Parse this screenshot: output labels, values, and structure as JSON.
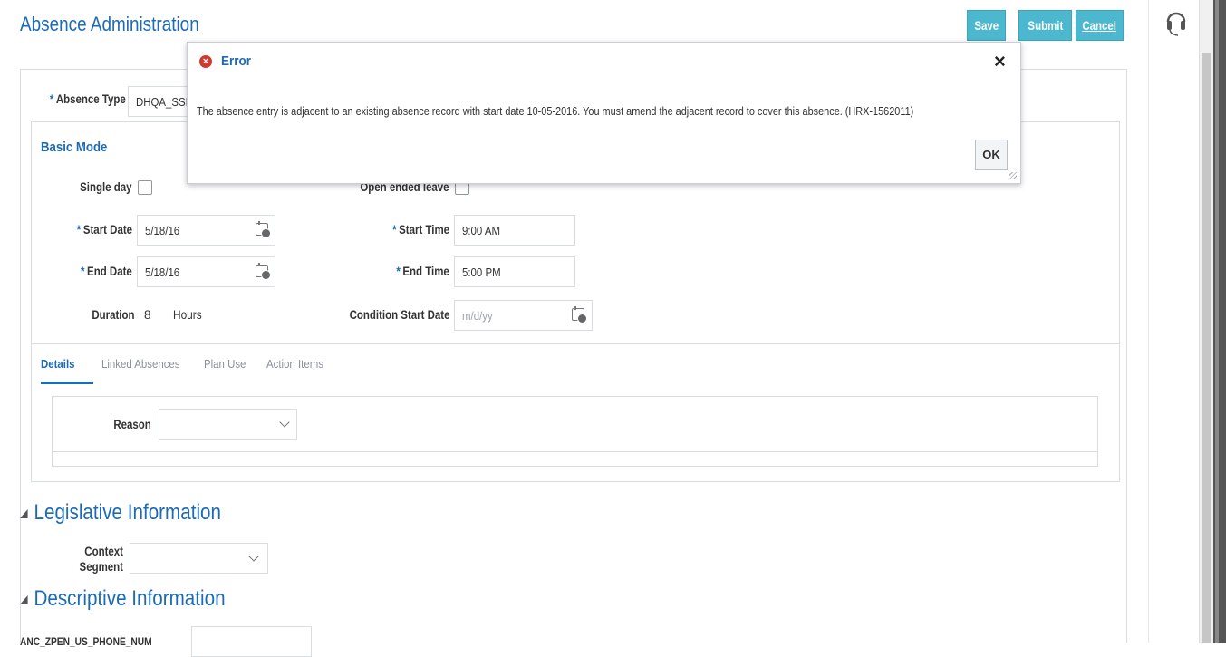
{
  "page": {
    "title": "Absence Administration",
    "save_label": "Save",
    "submit_label": "Submit",
    "cancel_label": "Cancel"
  },
  "form": {
    "absence_type_label": "Absence Type",
    "absence_type_value": "DHQA_SSI",
    "basic_mode_label": "Basic Mode",
    "single_day_label": "Single day",
    "open_ended_label": "Open ended leave",
    "start_date_label": "Start Date",
    "start_date_value": "5/18/16",
    "end_date_label": "End Date",
    "end_date_value": "5/18/16",
    "start_time_label": "Start Time",
    "start_time_value": "9:00 AM",
    "end_time_label": "End Time",
    "end_time_value": "5:00 PM",
    "duration_label": "Duration",
    "duration_value": "8",
    "duration_unit": "Hours",
    "condition_start_label": "Condition Start Date",
    "condition_start_placeholder": "m/d/yy",
    "required_marker": "*"
  },
  "tabs": [
    {
      "label": "Details",
      "active": true
    },
    {
      "label": "Linked Absences",
      "active": false
    },
    {
      "label": "Plan Use",
      "active": false
    },
    {
      "label": "Action Items",
      "active": false
    }
  ],
  "details": {
    "reason_label": "Reason"
  },
  "legislative": {
    "title": "Legislative Information",
    "context_segment_label_1": "Context",
    "context_segment_label_2": "Segment"
  },
  "descriptive": {
    "title": "Descriptive Information",
    "field_label": "ANC_ZPEN_US_PHONE_NUM"
  },
  "dialog": {
    "title": "Error",
    "message": "The absence entry is adjacent to an existing absence record with start date 10-05-2016. You must amend the adjacent record to cover this absence. (HRX-1562011)",
    "ok_label": "OK",
    "close_glyph": "×"
  },
  "colors": {
    "accent": "#1d6bb5",
    "button": "#4bb8cf",
    "error": "#d0392e"
  },
  "icons": [
    "calendar-icon",
    "headset-icon",
    "error-icon",
    "close-icon",
    "chevron-down-icon"
  ]
}
